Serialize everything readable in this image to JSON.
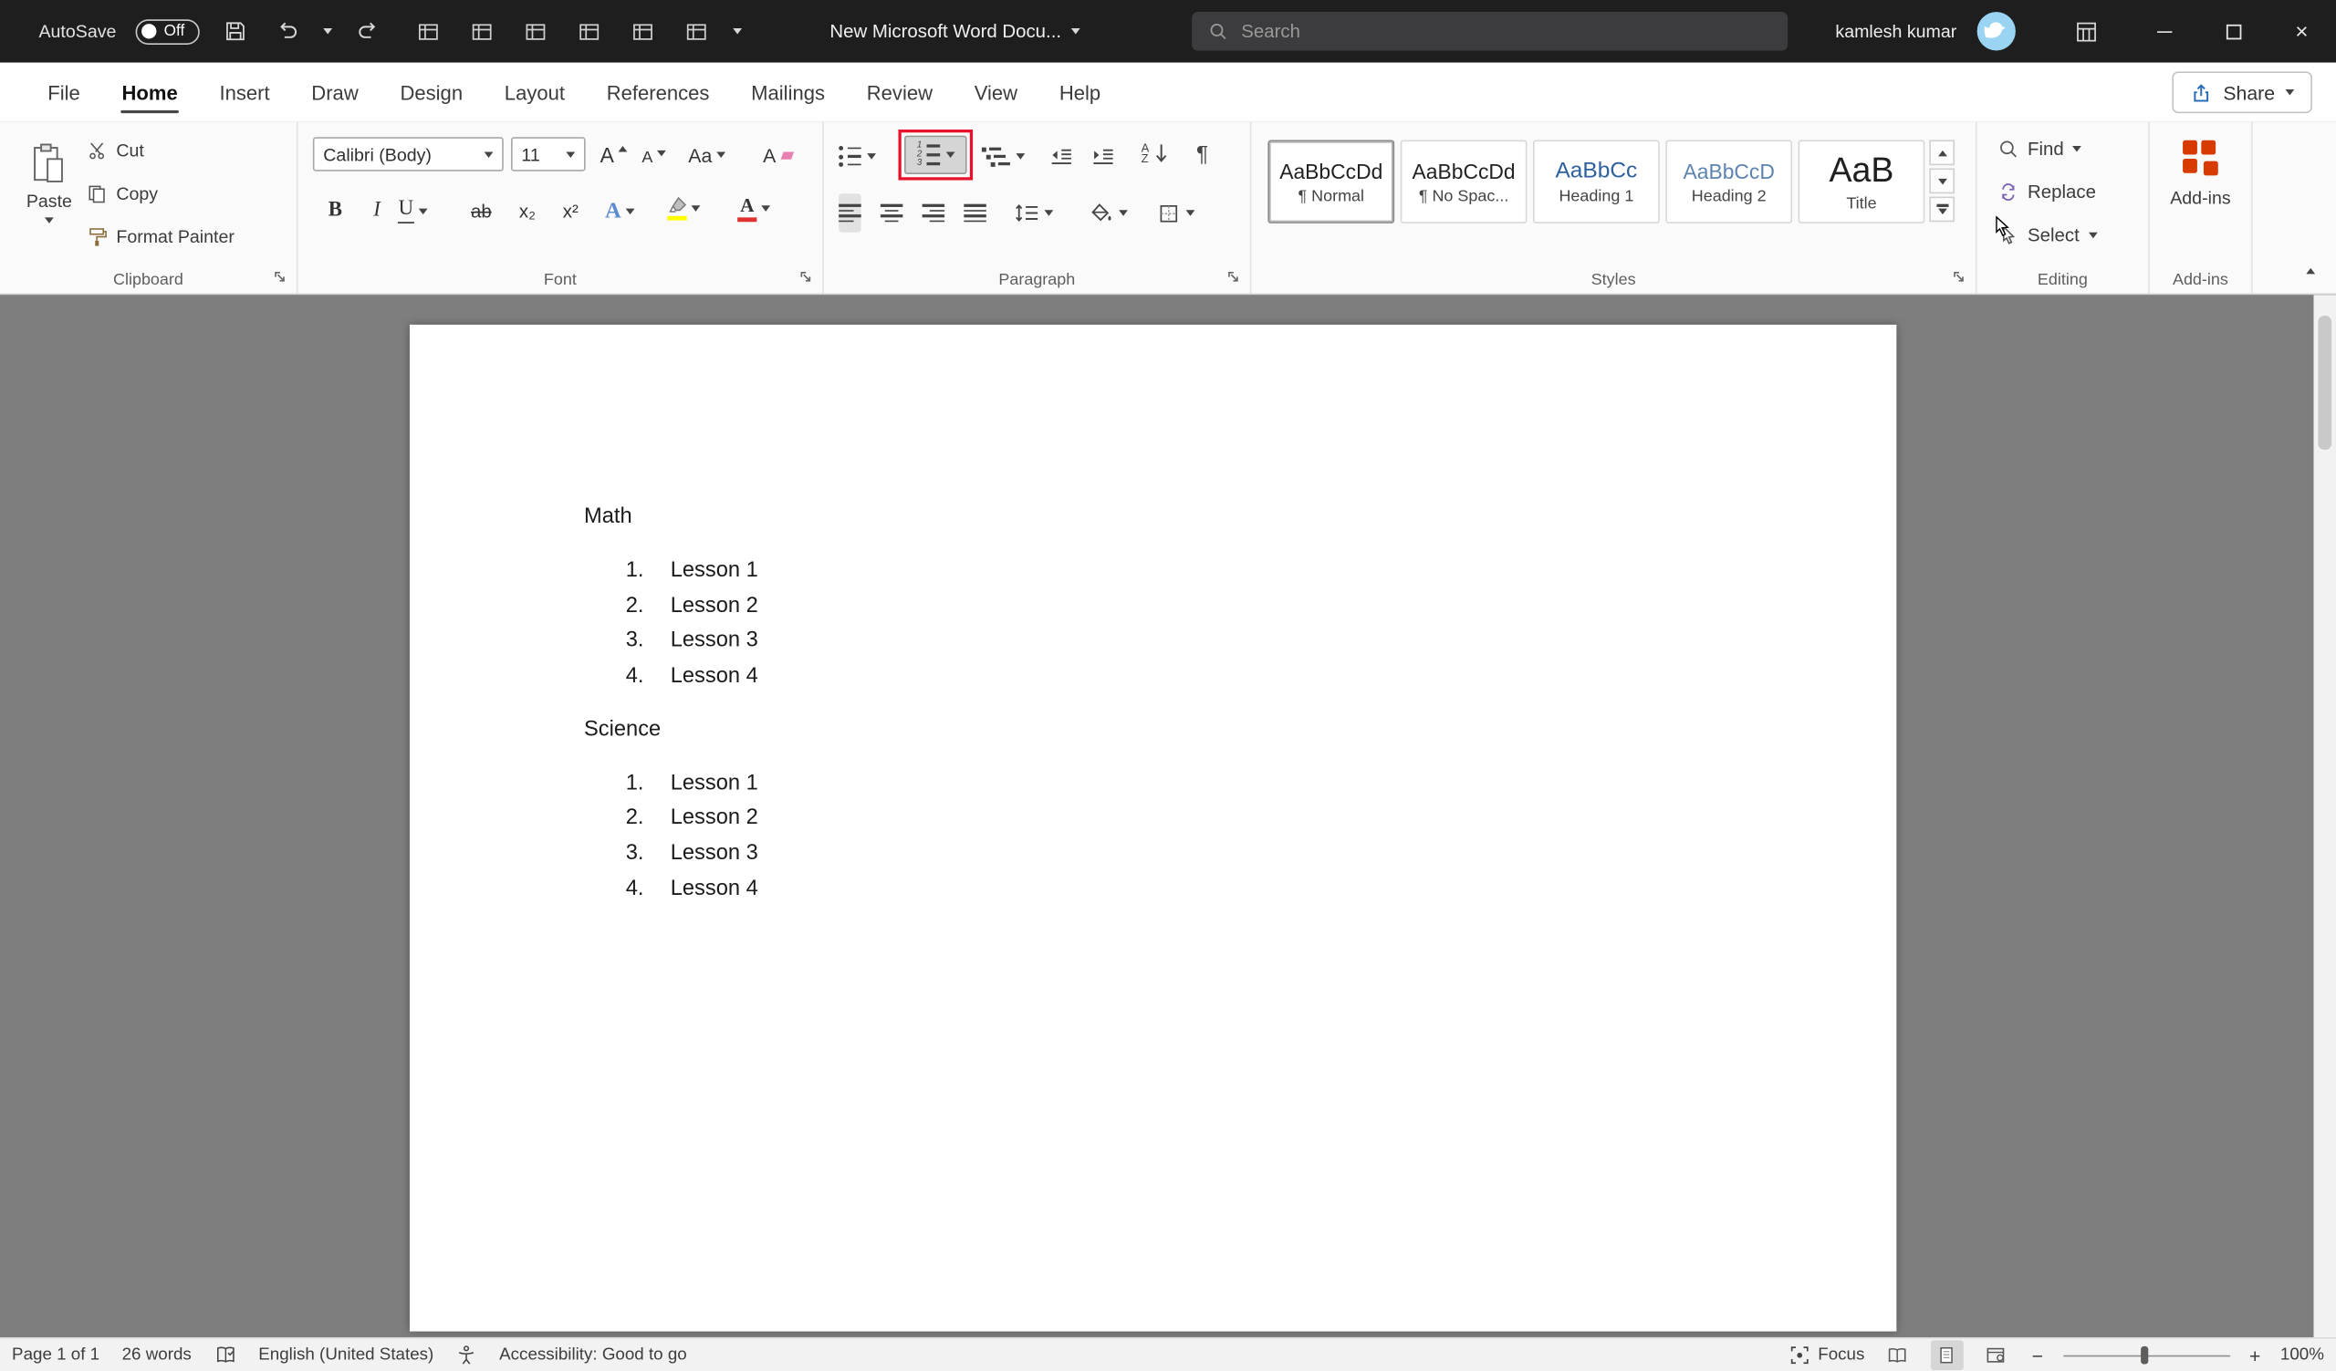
{
  "titlebar": {
    "autosave_label": "AutoSave",
    "autosave_state": "Off",
    "doc_title": "New Microsoft Word Docu...",
    "search_placeholder": "Search",
    "user_name": "kamlesh kumar"
  },
  "tabs": [
    {
      "label": "File"
    },
    {
      "label": "Home",
      "active": true
    },
    {
      "label": "Insert"
    },
    {
      "label": "Draw"
    },
    {
      "label": "Design"
    },
    {
      "label": "Layout"
    },
    {
      "label": "References"
    },
    {
      "label": "Mailings"
    },
    {
      "label": "Review"
    },
    {
      "label": "View"
    },
    {
      "label": "Help"
    }
  ],
  "share_button": {
    "label": "Share"
  },
  "ribbon": {
    "clipboard": {
      "group_label": "Clipboard",
      "paste_label": "Paste",
      "cut_label": "Cut",
      "copy_label": "Copy",
      "format_painter_label": "Format Painter"
    },
    "font": {
      "group_label": "Font",
      "font_name_value": "Calibri (Body)",
      "font_size_value": "11",
      "grow_font_glyph": "A",
      "shrink_font_glyph": "A",
      "change_case_glyph": "Aa",
      "clear_formatting_glyph": "A",
      "bold_glyph": "B",
      "italic_glyph": "I",
      "underline_glyph": "U",
      "strikethrough_glyph": "ab",
      "subscript_glyph": "x₂",
      "superscript_glyph": "x²",
      "text_effects_glyph": "A",
      "font_color_glyph": "A"
    },
    "paragraph": {
      "group_label": "Paragraph",
      "pilcrow_glyph": "¶",
      "sort_a": "A",
      "sort_z": "Z",
      "num_glyphs": [
        "1",
        "2",
        "3"
      ]
    },
    "styles": {
      "group_label": "Styles",
      "items": [
        {
          "preview": "AaBbCcDd",
          "label": "¶ Normal"
        },
        {
          "preview": "AaBbCcDd",
          "label": "¶ No Spac..."
        },
        {
          "preview": "AaBbCc",
          "label": "Heading 1"
        },
        {
          "preview": "AaBbCcD",
          "label": "Heading 2"
        },
        {
          "preview": "AaB",
          "label": "Title"
        }
      ]
    },
    "editing": {
      "group_label": "Editing",
      "find_label": "Find",
      "replace_label": "Replace",
      "select_label": "Select"
    },
    "addins": {
      "group_label": "Add-ins",
      "button_label": "Add-ins"
    }
  },
  "document": {
    "sections": [
      {
        "heading": "Math",
        "items": [
          {
            "num": "1.",
            "text": "Lesson 1"
          },
          {
            "num": "2.",
            "text": "Lesson 2"
          },
          {
            "num": "3.",
            "text": "Lesson 3"
          },
          {
            "num": "4.",
            "text": "Lesson 4"
          }
        ]
      },
      {
        "heading": "Science",
        "items": [
          {
            "num": "1.",
            "text": "Lesson 1"
          },
          {
            "num": "2.",
            "text": "Lesson 2"
          },
          {
            "num": "3.",
            "text": "Lesson 3"
          },
          {
            "num": "4.",
            "text": "Lesson 4"
          }
        ]
      }
    ]
  },
  "statusbar": {
    "page_info": "Page 1 of 1",
    "word_count": "26 words",
    "language": "English (United States)",
    "accessibility": "Accessibility: Good to go",
    "focus_label": "Focus",
    "zoom_out_glyph": "−",
    "zoom_in_glyph": "+",
    "zoom_value": "100%"
  },
  "colors": {
    "highlight_box_red": "#e8112d",
    "heading_blue": "#2e5f9e",
    "addins_orange": "#d83b01",
    "title_bar": "#1e1e1e"
  }
}
